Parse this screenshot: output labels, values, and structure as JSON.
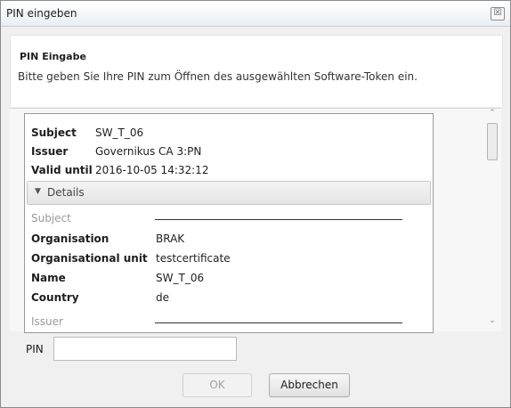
{
  "window": {
    "title": "PIN eingeben",
    "close_symbol": "☒"
  },
  "header": {
    "title": "PIN Eingabe",
    "description": "Bitte geben Sie Ihre PIN zum Öffnen des ausgewählten Software-Token ein."
  },
  "certificate": {
    "summary": [
      {
        "key": "Subject",
        "value": "SW_T_06"
      },
      {
        "key": "Issuer",
        "value": "Governikus CA 3:PN"
      },
      {
        "key": "Valid until",
        "value": "2016-10-05 14:32:12"
      }
    ],
    "details_label": "Details",
    "details_arrow": "▼",
    "subject_section": "Subject",
    "subject_fields": [
      {
        "key": "Organisation",
        "value": "BRAK"
      },
      {
        "key": "Organisational unit",
        "value": "testcertificate"
      },
      {
        "key": "Name",
        "value": "SW_T_06"
      },
      {
        "key": "Country",
        "value": "de"
      }
    ],
    "issuer_section": "Issuer"
  },
  "scroll": {
    "up_arrow": "⌃",
    "down_arrow": "⌄"
  },
  "pin": {
    "label": "PIN",
    "value": "",
    "placeholder": ""
  },
  "buttons": {
    "ok": "OK",
    "cancel": "Abbrechen"
  }
}
